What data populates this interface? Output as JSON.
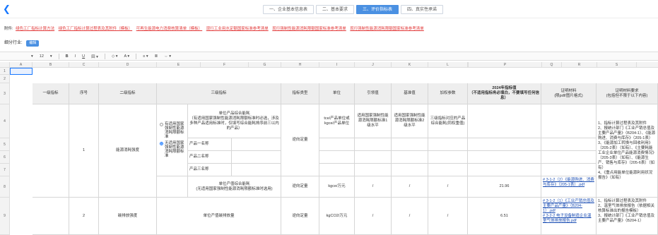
{
  "nav": {
    "back_icon": "chevron-left-icon",
    "steps": [
      "一、企业基本信息表",
      "二、基本要求",
      "三、评价指标表",
      "四、真实性承诺"
    ],
    "active_step": 2
  },
  "attachments": {
    "label": "附件:",
    "links": [
      "绿色工厂指标计算方法",
      "绿色工厂指标计算过程表及其附件（模板）",
      "可再生能源电力消费核算清单（模板）",
      "现行工业用水定额国家标准参考清单",
      "现行强制性能源消耗限额国家标准参考清单",
      "现行强制性能源消耗限额国家标准参考清单"
    ]
  },
  "industry": {
    "label": "细分行业:",
    "button": "编辑"
  },
  "toolbar": {
    "items": [
      "▾",
      "12",
      "▾",
      "B",
      "I",
      "U",
      "田 ▾",
      "◇ ▾",
      "A ▾",
      "≡ ▾",
      "≣",
      "⇔ ▾"
    ]
  },
  "sheet": {
    "columns": [
      "A",
      "B",
      "C",
      "D",
      "E",
      "F",
      "G",
      "H",
      "I",
      "J",
      "K",
      "L",
      "M",
      "N",
      "O",
      "P",
      "Q",
      "R",
      "S",
      "T"
    ],
    "rows": [
      "1",
      "2",
      "3",
      "4",
      "5",
      "6",
      "7",
      "8",
      "9"
    ],
    "headers": {
      "c_b": "一级指标",
      "c_c": "序号",
      "c_d": "二级指标",
      "c_ef": "三级指标",
      "c_h": "指标类型",
      "c_i": "单位",
      "c_j": "引领值",
      "c_k": "基准值",
      "c_l": "加权参数",
      "c_n": "2024年指标值\n（不适用指标务必填白，不要填写任何信息）",
      "c_s": "证明材料\n(限pdf/图片格式)",
      "c_t": "证明材料要求\n(包括但不限于以下内容)"
    },
    "r4": {
      "f": "单位产品综合能耗\n（有适用国家强制性能源消耗限额标准时必选，涉及多种产品适用标准时，仅填写综合能耗排序前三以内的产品）",
      "h": "",
      "i": "tce/产品单位或kgce/产品单位",
      "j": "适用国家强制性能源消耗限额标准1级水平",
      "k": "适用国家强制性能源消耗限额标准2级水平",
      "l": "三级指标对应的产品综合能耗(同权重值)"
    },
    "group1": {
      "seq": "1",
      "second": "能源消耗强度",
      "type": "逆向定量",
      "radio_a": "有适用国家强制性能源消耗限额标准",
      "radio_b": "无适用国家强制性能源消耗限额标准"
    },
    "products": [
      "产品一名称",
      "产品二名称",
      "产品三名称"
    ],
    "r8": {
      "f": "单位产值综合能耗\n(无适用国家强制性能源消耗限额标准时选用)",
      "h": "逆向定量",
      "i": "kgce/万元",
      "j": "/",
      "k": "/",
      "l": "/",
      "n": "21.96",
      "s": "# 3-1-2（2）《能源购进、消费与库存》（205-1表）.pdf"
    },
    "t_group1": "1、指标计算过程表及其附件\n2、报统计部门《工业产销总值及主要产品产量》（B204-1）、《能源购进、消费与库存》（205-1表）\n3、《能源加工转换与回收利用》（205-2表）（如有）、《主要耗能工业企业单位产品能源消费情况》（205-3表）（如有）、《能源生产、销售与库存》（205-6表）（如有）\n4、《重点用能单位能源利用状况报告》（如有）",
    "r9": {
      "seq": "2",
      "second": "碳排放强度",
      "third": "单位产值碳排放量",
      "h": "逆向定量",
      "i": "kgCO2/万元",
      "j": "/",
      "k": "/",
      "l": "/",
      "n": "6.51",
      "s": "# 3-1-2（1）《工业产销总值及主要产品产量》（B204-1）.pdf\n# 3-2-2 电子设备制造企业温室气体排放报告.pdf",
      "t": "1、指标计算过程表及其附件\n2、温室气体排放报告（依据相关核算标准出的报告模板）\n3、报统计部门《工业产销总值及主要产品产量》（B204-1）"
    }
  }
}
